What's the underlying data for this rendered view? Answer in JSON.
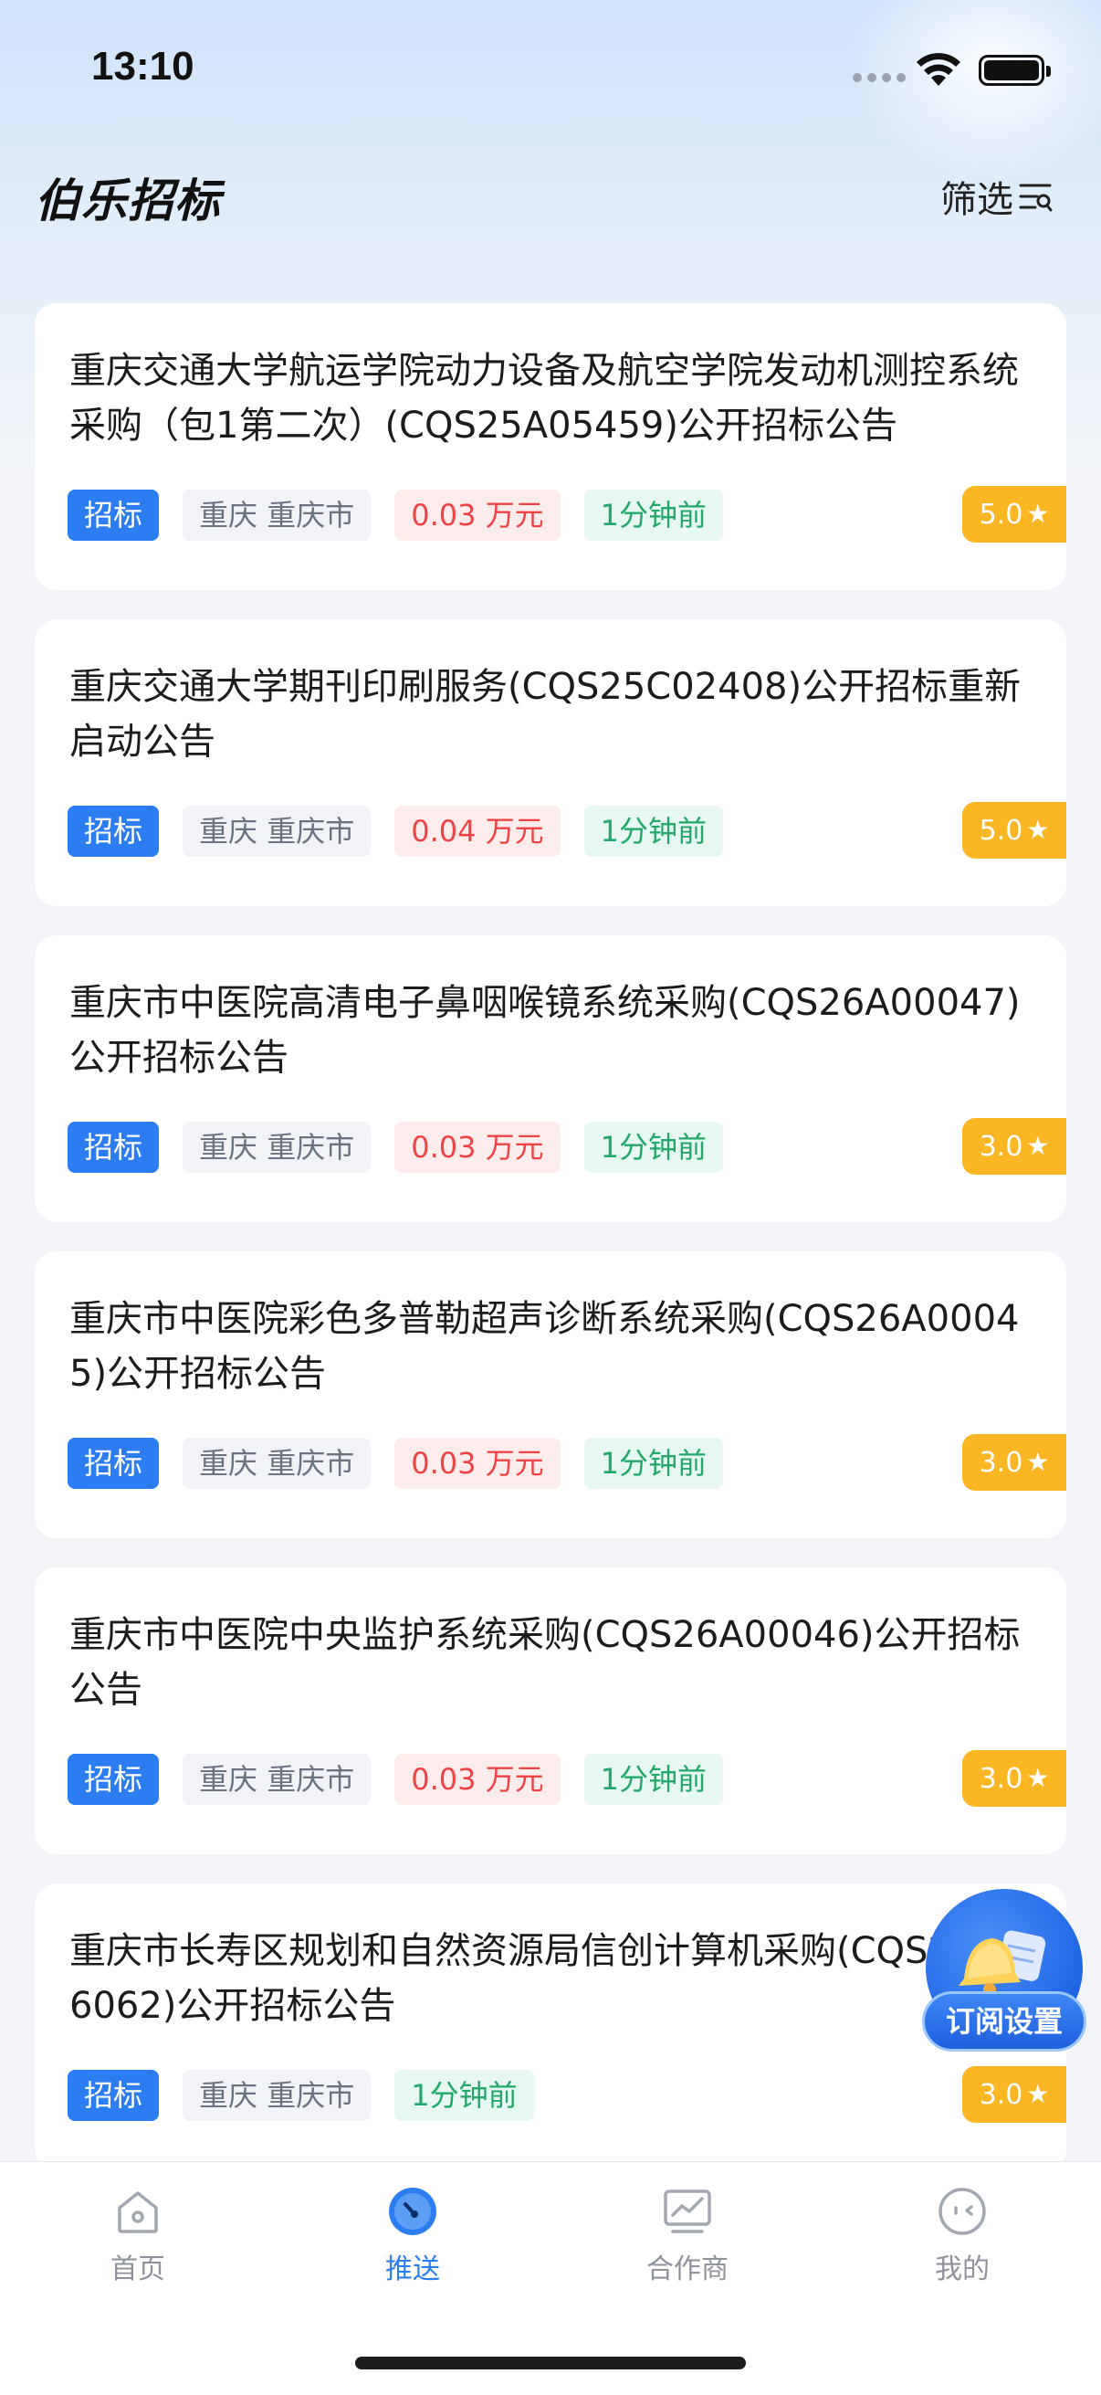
{
  "status_bar": {
    "time": "13:10"
  },
  "header": {
    "title": "伯乐招标",
    "filter_label": "筛选"
  },
  "items": [
    {
      "title": "重庆交通大学航运学院动力设备及航空学院发动机测控系统采购（包1第二次）(CQS25A05459)公开招标公告",
      "type": "招标",
      "region": "重庆 重庆市",
      "amount": "0.03 万元",
      "time": "1分钟前",
      "rating": "5.0"
    },
    {
      "title": "重庆交通大学期刊印刷服务(CQS25C02408)公开招标重新启动公告",
      "type": "招标",
      "region": "重庆 重庆市",
      "amount": "0.04 万元",
      "time": "1分钟前",
      "rating": "5.0"
    },
    {
      "title": "重庆市中医院高清电子鼻咽喉镜系统采购(CQS26A00047)公开招标公告",
      "type": "招标",
      "region": "重庆 重庆市",
      "amount": "0.03 万元",
      "time": "1分钟前",
      "rating": "3.0"
    },
    {
      "title": "重庆市中医院彩色多普勒超声诊断系统采购(CQS26A00045)公开招标公告",
      "type": "招标",
      "region": "重庆 重庆市",
      "amount": "0.03 万元",
      "time": "1分钟前",
      "rating": "3.0"
    },
    {
      "title": "重庆市中医院中央监护系统采购(CQS26A00046)公开招标公告",
      "type": "招标",
      "region": "重庆 重庆市",
      "amount": "0.03 万元",
      "time": "1分钟前",
      "rating": "3.0"
    },
    {
      "title": "重庆市长寿区规划和自然资源局信创计算机采购(CQS25A06062)公开招标公告",
      "type": "招标",
      "region": "重庆 重庆市",
      "amount": "",
      "time": "1分钟前",
      "rating": "3.0"
    }
  ],
  "fab": {
    "label": "订阅设置"
  },
  "tabs": [
    {
      "label": "首页",
      "icon": "home-icon",
      "active": false
    },
    {
      "label": "推送",
      "icon": "push-gauge-icon",
      "active": true
    },
    {
      "label": "合作商",
      "icon": "partner-chart-icon",
      "active": false
    },
    {
      "label": "我的",
      "icon": "profile-face-icon",
      "active": false
    }
  ],
  "colors": {
    "accent": "#2d7df2",
    "amount_red": "#ef4444",
    "time_green": "#22a86b",
    "rating_orange": "#fbb624"
  }
}
